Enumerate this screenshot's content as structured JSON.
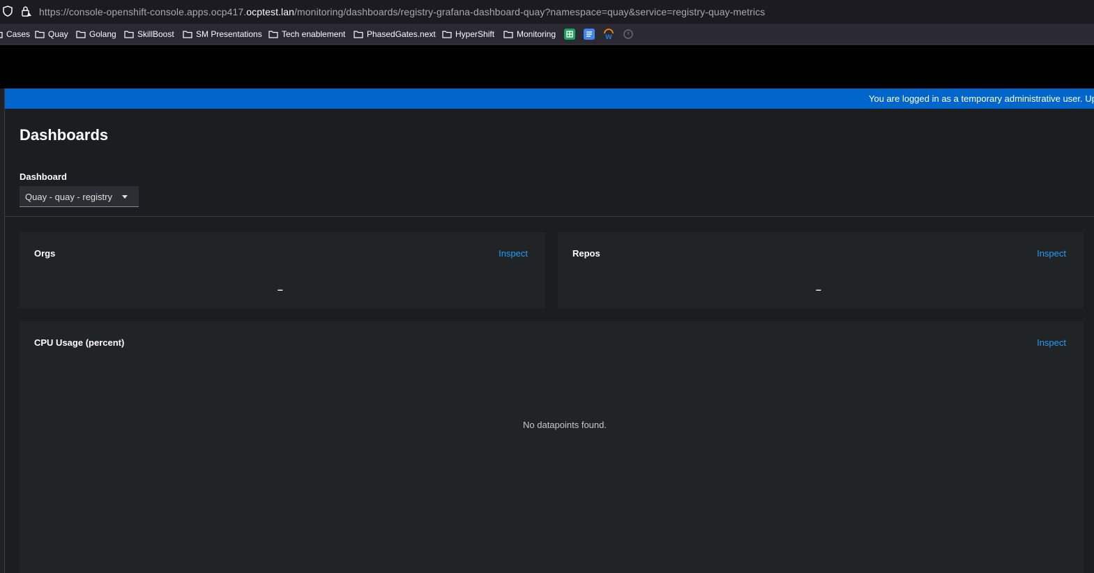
{
  "browser": {
    "url_prefix": "https://console-openshift-console.apps.ocp417.",
    "url_domain": "ocptest.lan",
    "url_suffix": "/monitoring/dashboards/registry-grafana-dashboard-quay?namespace=quay&service=registry-quay-metrics",
    "bookmarks": [
      {
        "label": "Cases",
        "icon": "folder-icon"
      },
      {
        "label": "Quay",
        "icon": "folder-icon"
      },
      {
        "label": "Golang",
        "icon": "folder-icon"
      },
      {
        "label": "SkillBoost",
        "icon": "folder-icon"
      },
      {
        "label": "SM Presentations",
        "icon": "folder-icon"
      },
      {
        "label": "Tech enablement",
        "icon": "folder-icon"
      },
      {
        "label": "PhasedGates.next",
        "icon": "folder-icon"
      },
      {
        "label": "HyperShift",
        "icon": "folder-icon"
      },
      {
        "label": "Monitoring",
        "icon": "folder-icon"
      }
    ],
    "extension_icons": [
      "google-sheets-icon",
      "google-docs-icon",
      "workday-icon",
      "history-icon"
    ]
  },
  "banner": {
    "text": "You are logged in as a temporary administrative user. Upda"
  },
  "page": {
    "title": "Dashboards",
    "dashboard_label": "Dashboard",
    "dashboard_selected": "Quay - quay - registry"
  },
  "cards": {
    "orgs": {
      "title": "Orgs",
      "link": "Inspect",
      "value": "–"
    },
    "repos": {
      "title": "Repos",
      "link": "Inspect",
      "value": "–"
    },
    "cpu": {
      "title": "CPU Usage (percent)",
      "link": "Inspect",
      "empty": "No datapoints found."
    }
  },
  "colors": {
    "banner": "#0066cc",
    "link": "#2b9af3",
    "card_bg": "#212427",
    "page_bg": "#1b1d21"
  }
}
